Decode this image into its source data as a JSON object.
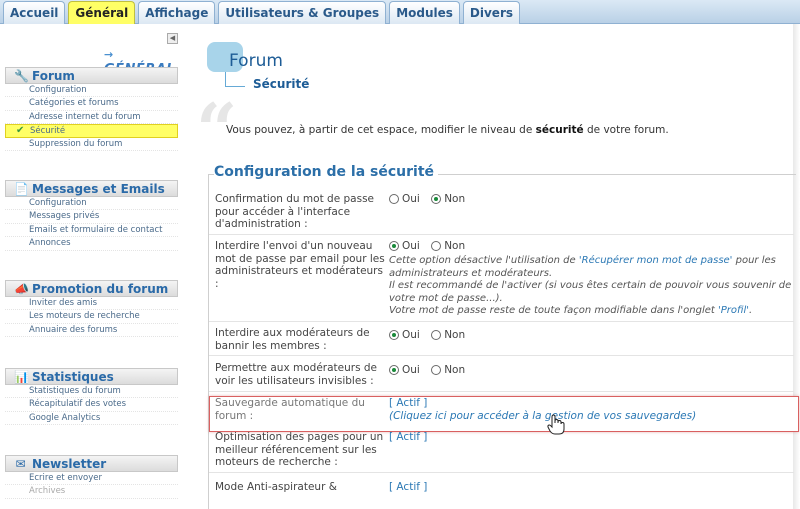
{
  "tabs": [
    "Accueil",
    "Général",
    "Affichage",
    "Utilisateurs & Groupes",
    "Modules",
    "Divers"
  ],
  "sidebar": {
    "section_label": "GÉNÉRAL",
    "section_arrow": "→",
    "groups": [
      {
        "title": "Forum",
        "icon": "wrench-icon",
        "items": [
          "Configuration",
          "Catégories et forums",
          "Adresse internet du forum",
          "Sécurité",
          "Suppression du forum"
        ]
      },
      {
        "title": "Messages et Emails",
        "icon": "document-icon",
        "items": [
          "Configuration",
          "Messages privés",
          "Emails et formulaire de contact",
          "Annonces"
        ]
      },
      {
        "title": "Promotion du forum",
        "icon": "megaphone-icon",
        "items": [
          "Inviter des amis",
          "Les moteurs de recherche",
          "Annuaire des forums"
        ]
      },
      {
        "title": "Statistiques",
        "icon": "chart-icon",
        "items": [
          "Statistiques du forum",
          "Récapitulatif des votes",
          "Google Analytics"
        ]
      },
      {
        "title": "Newsletter",
        "icon": "newsletter-icon",
        "items": [
          "Ecrire et envoyer",
          "Archives"
        ]
      }
    ]
  },
  "main": {
    "title": "Forum",
    "subtitle": "Sécurité",
    "intro_before": "Vous pouvez, à partir de cet espace, modifier le niveau de ",
    "intro_bold": "sécurité",
    "intro_after": " de votre forum.",
    "fieldset_title": "Configuration de la sécurité",
    "rows": [
      {
        "label": "Confirmation du mot de passe pour accéder à l'interface d'administration :",
        "opt1": "Oui",
        "opt2": "Non",
        "selected": "Non"
      },
      {
        "label": "Interdire l'envoi d'un nouveau mot de passe par email pour les administrateurs et modérateurs :",
        "opt1": "Oui",
        "opt2": "Non",
        "selected": "Oui",
        "note1": "Cette option désactive l'utilisation de ",
        "note1_link": "'Récupérer mon mot de passe'",
        "note1_after": " pour les administrateurs et modérateurs.",
        "note2": "Il est recommandé de l'activer (si vous êtes certain de pouvoir vous souvenir de votre mot de passe...).",
        "note3": "Votre mot de passe reste de toute façon modifiable dans l'onglet ",
        "note3_link": "'Profil'",
        "note3_after": "."
      },
      {
        "label": "Interdire aux modérateurs de bannir les membres :",
        "opt1": "Oui",
        "opt2": "Non",
        "selected": "Oui"
      },
      {
        "label": "Permettre aux modérateurs de voir les utilisateurs invisibles :",
        "opt1": "Oui",
        "opt2": "Non",
        "selected": "Oui"
      },
      {
        "label": "Sauvegarde automatique du forum :",
        "value": "[ Actif ]",
        "link": "(Cliquez ici pour accéder à la gestion de vos sauvegardes)"
      },
      {
        "label": "Optimisation des pages pour un meilleur référencement sur les moteurs de recherche :",
        "value": "[ Actif ]"
      },
      {
        "label": "Mode Anti-aspirateur &",
        "value": "[ Actif ]"
      }
    ]
  }
}
